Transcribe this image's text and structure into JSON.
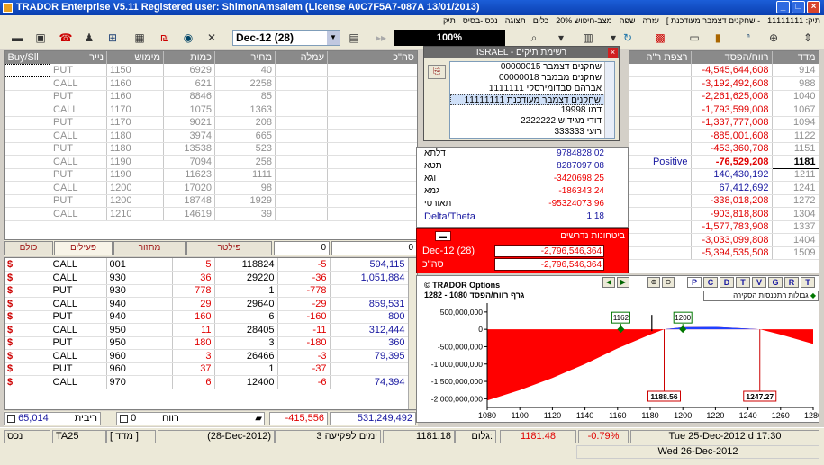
{
  "window": {
    "title": "TRADOR Enterprise  V5.11    Registered user: ShimonAmsalem   (License  A0C7F5A7-087A  13/01/2013)"
  },
  "menu": {
    "items": [
      "תיק: 11111111",
      "- שחקנים דצמבר מעודכנת ]",
      "עזרה",
      "שפה",
      "מצב-חיפוש 20%",
      "כלים",
      "תצוגה",
      "נכסי-בסיס",
      "תיק"
    ]
  },
  "toolbar": {
    "contract": "Dec-12 (28)",
    "percent": "100%"
  },
  "options_table": {
    "headers": [
      "Buy/Sll",
      "נייר",
      "מימוש",
      "כמות",
      "מחיר",
      "עמלה",
      "סה\"כ"
    ],
    "rows": [
      [
        "",
        "PUT",
        "1150",
        "6929",
        "40"
      ],
      [
        "",
        "CALL",
        "1160",
        "621",
        "2258"
      ],
      [
        "",
        "PUT",
        "1160",
        "8846",
        "85"
      ],
      [
        "",
        "CALL",
        "1170",
        "1075",
        "1363"
      ],
      [
        "",
        "PUT",
        "1170",
        "9021",
        "208"
      ],
      [
        "",
        "CALL",
        "1180",
        "3974",
        "665"
      ],
      [
        "",
        "PUT",
        "1180",
        "13538",
        "523"
      ],
      [
        "",
        "CALL",
        "1190",
        "7094",
        "258"
      ],
      [
        "",
        "PUT",
        "1190",
        "11623",
        "1111"
      ],
      [
        "",
        "CALL",
        "1200",
        "17020",
        "98"
      ],
      [
        "",
        "PUT",
        "1200",
        "18748",
        "1929"
      ],
      [
        "",
        "CALL",
        "1210",
        "14619",
        "39"
      ]
    ]
  },
  "tabs": {
    "all": "כולם",
    "active": "פעילים",
    "turnover": "מחזור",
    "filter": "פילטר",
    "zero1": "0",
    "zero2": "0"
  },
  "positions": {
    "rows": [
      [
        "$",
        "CALL",
        "001",
        "5",
        "118824",
        "-5",
        "594,115"
      ],
      [
        "$",
        "CALL",
        "930",
        "36",
        "29220",
        "-36",
        "1,051,884"
      ],
      [
        "$",
        "PUT",
        "930",
        "778",
        "1",
        "-778",
        ""
      ],
      [
        "$",
        "CALL",
        "940",
        "29",
        "29640",
        "-29",
        "859,531"
      ],
      [
        "$",
        "PUT",
        "940",
        "160",
        "6",
        "-160",
        "800"
      ],
      [
        "$",
        "CALL",
        "950",
        "11",
        "28405",
        "-11",
        "312,444"
      ],
      [
        "$",
        "PUT",
        "950",
        "180",
        "3",
        "-180",
        "360"
      ],
      [
        "$",
        "CALL",
        "960",
        "3",
        "26466",
        "-3",
        "79,395"
      ],
      [
        "$",
        "PUT",
        "960",
        "37",
        "1",
        "-37",
        ""
      ],
      [
        "$",
        "CALL",
        "970",
        "6",
        "12400",
        "-6",
        "74,394"
      ]
    ]
  },
  "pos_footer": {
    "interest_val": "65,014",
    "interest_label": "ריבית",
    "profit_val": "0",
    "profit_label": "רווח",
    "total1": "-415,556",
    "total2": "531,249,492"
  },
  "portfolio": {
    "title": "ISRAEL - רשימת תיקים",
    "items": [
      "שחקנים דצמבר 00000015",
      "שחקנים מבמבר 00000018",
      "אברהם סבדומירסקי 1111111",
      "שחקנים דצמבר מעודכנת 11111111",
      "דמו 19998",
      "דודי מגידוש 2222222",
      "רועי 333333"
    ],
    "selected": 3
  },
  "greeks": {
    "rows": [
      {
        "label": "דלתא",
        "value": "9784828.02"
      },
      {
        "label": "תטא",
        "value": "8287097.08"
      },
      {
        "label": "וגא",
        "value": "-3420698.25"
      },
      {
        "label": "גמא",
        "value": "-186343.24"
      },
      {
        "label": "תאורטי",
        "value": "-95324073.96"
      },
      {
        "label": "Delta/Theta",
        "value": "1.18"
      }
    ]
  },
  "required_margin": {
    "title": "ביטחונות נדרשים",
    "contract": "Dec-12 (28)",
    "contract_value": "-2,796,546,364",
    "total_label": "סה\"כ",
    "total_value": "-2,796,546,364"
  },
  "pnl_table": {
    "headers": [
      "רצפת ר\"ה",
      "רווח/הפסד",
      "מדד"
    ],
    "rows": [
      [
        "",
        "-4,545,644,608",
        "914"
      ],
      [
        "",
        "-3,192,492,608",
        "988"
      ],
      [
        "",
        "-2,261,625,008",
        "1040"
      ],
      [
        "",
        "-1,793,599,008",
        "1067"
      ],
      [
        "",
        "-1,337,777,008",
        "1094"
      ],
      [
        "",
        "-885,001,608",
        "1122"
      ],
      [
        "",
        "-453,360,708",
        "1151"
      ],
      [
        "Positive",
        "-76,529,208",
        "1181"
      ],
      [
        "",
        "140,430,192",
        "1211"
      ],
      [
        "",
        "67,412,692",
        "1241"
      ],
      [
        "",
        "-338,018,208",
        "1272"
      ],
      [
        "",
        "-903,818,808",
        "1304"
      ],
      [
        "",
        "-1,577,783,908",
        "1337"
      ],
      [
        "",
        "-3,033,099,808",
        "1404"
      ],
      [
        "",
        "-5,394,535,508",
        "1509"
      ]
    ],
    "highlight_row": 7
  },
  "chart_header": {
    "brand": "© TRADOR Options",
    "subtitle": "גרף רווח/הפסד 1080 - 1282",
    "buttons": [
      "P",
      "C",
      "D",
      "T",
      "V",
      "G",
      "R",
      "T"
    ],
    "limits_label": "גבולות התכנסות הסקירה"
  },
  "chart_data": {
    "type": "area",
    "x": [
      1080,
      1100,
      1120,
      1140,
      1160,
      1180,
      1188.56,
      1200,
      1220,
      1240,
      1247.27,
      1260,
      1280
    ],
    "y": [
      -2050000000,
      -1750000000,
      -1400000000,
      -1000000000,
      -550000000,
      -150000000,
      0,
      60000000,
      70000000,
      20000000,
      0,
      -150000000,
      -420000000
    ],
    "xlim": [
      1080,
      1280
    ],
    "ylim": [
      -2250000000,
      600000000
    ],
    "xticks": [
      "1080",
      "1100",
      "1120",
      "1140",
      "1160",
      "1180",
      "1200",
      "1220",
      "1240",
      "1260",
      "1280"
    ],
    "yticks": [
      "500,000,000",
      "0",
      "-500,000,000",
      "-1,000,000,000",
      "-1,500,000,000",
      "-2,000,000,000"
    ],
    "annotations": [
      {
        "label": "1162",
        "x": 1162
      },
      {
        "label": "1200",
        "x": 1200
      },
      {
        "label": "1188.56",
        "x": 1188.56
      },
      {
        "label": "1247.27",
        "x": 1247.27
      }
    ],
    "current_index": 1181,
    "negative_color": "#ff0000",
    "positive_color": "#2040ff"
  },
  "status": {
    "asset": "נכס",
    "ta25": "TA25",
    "index_label": "[ מדד ]",
    "expiry": "(28-Dec-2012)",
    "days": "ימים לפקיעה 3",
    "gilum_label": "גלום:",
    "gilum": "1181.18",
    "last": "1181.48",
    "change": "-0.79%",
    "time": "Tue  25-Dec-2012  d 17:30",
    "date2": "Wed  26-Dec-2012"
  }
}
